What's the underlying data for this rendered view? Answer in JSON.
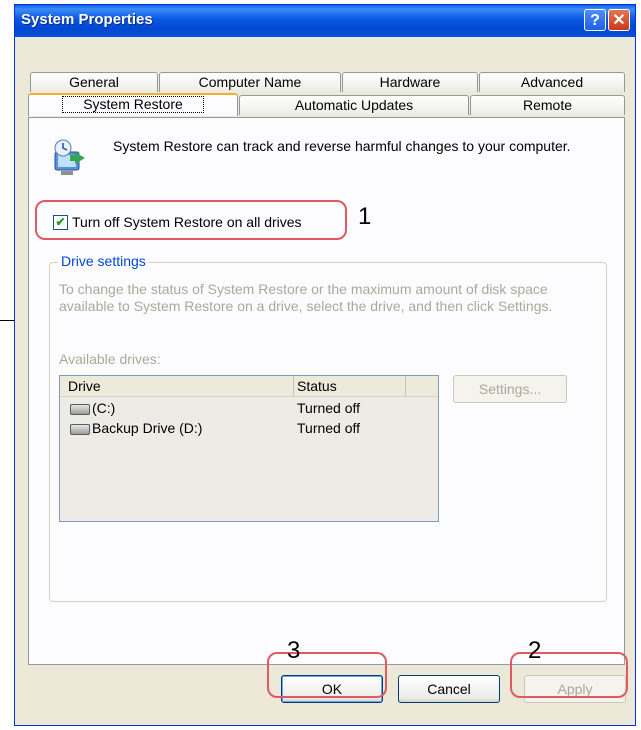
{
  "window": {
    "title": "System Properties",
    "help_button": "?",
    "close_button": "✕"
  },
  "tabs_row1": [
    "General",
    "Computer Name",
    "Hardware",
    "Advanced"
  ],
  "tabs_row2": [
    "System Restore",
    "Automatic Updates",
    "Remote"
  ],
  "active_tab": "System Restore",
  "description": "System Restore can track and reverse harmful changes to your computer.",
  "checkbox": {
    "label": "Turn off System Restore on all drives",
    "checked": true
  },
  "drive_settings": {
    "legend": "Drive settings",
    "description": "To change the status of System Restore or the maximum amount of disk space available to System Restore on a drive, select the drive, and then click Settings.",
    "available_label": "Available drives:",
    "columns": [
      "Drive",
      "Status"
    ],
    "rows": [
      {
        "drive": "(C:)",
        "status": "Turned off"
      },
      {
        "drive": "Backup Drive (D:)",
        "status": "Turned off"
      }
    ],
    "settings_button": "Settings..."
  },
  "buttons": {
    "ok": "OK",
    "cancel": "Cancel",
    "apply": "Apply"
  },
  "annotations": {
    "n1": "1",
    "n2": "2",
    "n3": "3",
    "highlight_color": "#e05a62"
  }
}
